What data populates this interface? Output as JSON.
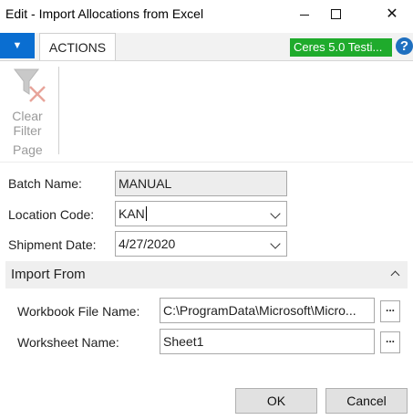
{
  "window": {
    "title": "Edit - Import Allocations from Excel",
    "minimize_icon": "minimize-icon",
    "maximize_icon": "maximize-icon",
    "close_glyph": "✕"
  },
  "ribbon": {
    "menu_glyph": "▼",
    "tab_label": "ACTIONS",
    "company_badge": "Ceres 5.0 Testi...",
    "help_glyph": "?",
    "colors": {
      "menu_blue": "#0a6ed1",
      "badge_green": "#1fab2c",
      "help_blue": "#1e6fbf"
    },
    "actions": [
      {
        "label_line1": "Clear",
        "label_line2": "Filter",
        "icon": "clear-filter-icon",
        "enabled": false
      }
    ],
    "group_label": "Page"
  },
  "form": {
    "batch_name": {
      "label": "Batch Name:",
      "value": "MANUAL"
    },
    "location_code": {
      "label": "Location Code:",
      "value": "KAN"
    },
    "shipment_date": {
      "label": "Shipment Date:",
      "value": "4/27/2020"
    }
  },
  "import_from": {
    "title": "Import From",
    "workbook_file_name": {
      "label": "Workbook File Name:",
      "value": "C:\\ProgramData\\Microsoft\\Micro...",
      "assist": "..."
    },
    "worksheet_name": {
      "label": "Worksheet Name:",
      "value": "Sheet1",
      "assist": "..."
    }
  },
  "buttons": {
    "ok": "OK",
    "cancel": "Cancel"
  }
}
